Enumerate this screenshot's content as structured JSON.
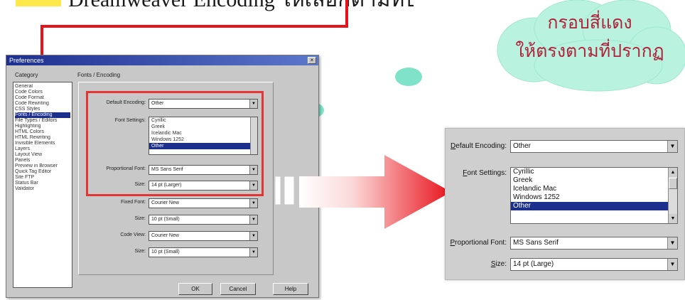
{
  "heading": {
    "text": "Dreamweaver Encoding ให้เลือกตามที่ปรากฏ"
  },
  "cloud": {
    "line1": "กรอบสี่แดง",
    "line2": "ให้ตรงตามที่ปรากฏ"
  },
  "dialog": {
    "title": "Preferences",
    "close_glyph": "×",
    "category_label": "Category",
    "section_title": "Fonts / Encoding",
    "categories": [
      "General",
      "Code Colors",
      "Code Format",
      "Code Rewriting",
      "CSS Styles",
      "Fonts / Encoding",
      "File Types / Editors",
      "Highlighting",
      "HTML Colors",
      "HTML Rewriting",
      "Invisible Elements",
      "Layers",
      "Layout View",
      "Panels",
      "Preview in Browser",
      "Quick Tag Editor",
      "Site FTP",
      "Status Bar",
      "Validator"
    ],
    "selected_category": "Fonts / Encoding",
    "fields": {
      "default_encoding": {
        "label": "Default Encoding:",
        "value": "Other"
      },
      "font_settings": {
        "label": "Font Settings:",
        "options": [
          "Cyrillic",
          "Greek",
          "Icelandic Mac",
          "Windows 1252",
          "Other"
        ],
        "selected": "Other"
      },
      "proportional_font": {
        "label": "Proportional Font:",
        "value": "MS Sans Serif"
      },
      "size1": {
        "label": "Size:",
        "value": "14 pt (Larger)"
      },
      "fixed_font": {
        "label": "Fixed Font:",
        "value": "Courier New"
      },
      "size2": {
        "label": "Size:",
        "value": "10 pt (Small)"
      },
      "code_view": {
        "label": "Code View:",
        "value": "Courier New"
      },
      "size3": {
        "label": "Size:",
        "value": "10 pt (Small)"
      }
    },
    "buttons": {
      "ok": "OK",
      "cancel": "Cancel",
      "help": "Help"
    },
    "dropdown_glyph": "▼"
  },
  "zoom": {
    "default_encoding": {
      "label_u": "D",
      "label_rest": "efault Encoding:",
      "value": "Other"
    },
    "font_settings": {
      "label_u": "F",
      "label_rest": "ont Settings:",
      "options": [
        "Cyrillic",
        "Greek",
        "Icelandic Mac",
        "Windows 1252",
        "Other"
      ],
      "selected": "Other"
    },
    "proportional_font": {
      "label_u": "P",
      "label_rest": "roportional Font:",
      "value": "MS Sans Serif"
    },
    "size": {
      "label_u": "S",
      "label_rest": "ize:",
      "value": "14 pt (Large)"
    },
    "dropdown_glyph": "▼",
    "scroll_up_glyph": "▲",
    "scroll_down_glyph": "▼"
  },
  "colors": {
    "accent_red": "#e53434",
    "arrow_red": "#e8121b",
    "cloud_green": "#b9f3e0",
    "selection_blue": "#1c2f8c"
  }
}
